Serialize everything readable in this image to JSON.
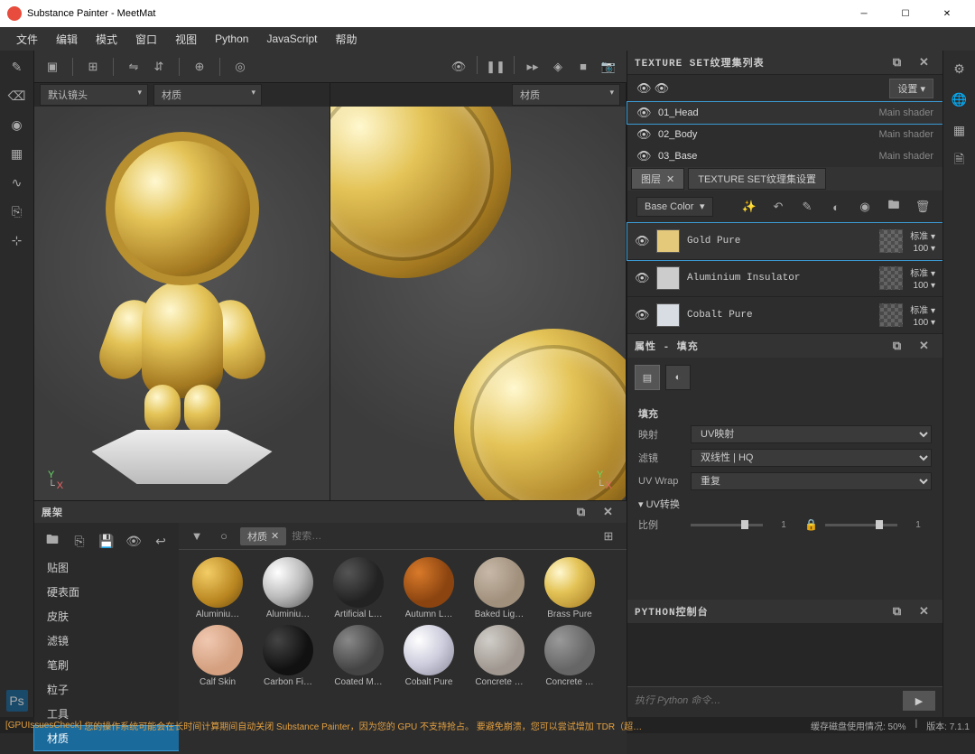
{
  "titlebar": {
    "title": "Substance Painter - MeetMat"
  },
  "menu": {
    "file": "文件",
    "edit": "编辑",
    "mode": "模式",
    "window": "窗口",
    "view": "视图",
    "python": "Python",
    "javascript": "JavaScript",
    "help": "帮助"
  },
  "viewport": {
    "lens": "默认镜头",
    "mat3d": "材质",
    "mat2d": "材质",
    "axis_x": "X",
    "axis_y": "Y"
  },
  "textureset": {
    "title": "TEXTURE SET纹理集列表",
    "settings": "设置",
    "rows": [
      {
        "name": "01_Head",
        "shader": "Main shader"
      },
      {
        "name": "02_Body",
        "shader": "Main shader"
      },
      {
        "name": "03_Base",
        "shader": "Main shader"
      }
    ]
  },
  "tabs": {
    "layers": "图层",
    "ts_settings": "TEXTURE SET纹理集设置"
  },
  "layers": {
    "channel": "Base Color",
    "blend": "标准",
    "opacity": "100",
    "items": [
      {
        "name": "Gold Pure",
        "color": "#e4c97a"
      },
      {
        "name": "Aluminium Insulator",
        "color": "#cccccc"
      },
      {
        "name": "Cobalt Pure",
        "color": "#d8dde4"
      }
    ]
  },
  "props": {
    "title": "属性 - 填充",
    "fill": "填充",
    "projection_label": "映射",
    "projection_value": "UV映射",
    "filtering_label": "滤镜",
    "filtering_value": "双线性 | HQ",
    "uvwrap_label": "UV Wrap",
    "uvwrap_value": "重复",
    "uvtransform": "UV转换",
    "scale_label": "比例",
    "scale_value": "1"
  },
  "console": {
    "title": "PYTHON控制台",
    "placeholder": "执行 Python 命令…"
  },
  "shelf": {
    "title": "展架",
    "search_chip": "材质",
    "search_placeholder": "搜索…",
    "categories": {
      "texture": "贴图",
      "hardsurface": "硬表面",
      "skin": "皮肤",
      "filter": "滤镜",
      "brush": "笔刷",
      "particle": "粒子",
      "tool": "工具",
      "material": "材质"
    },
    "materials": [
      {
        "label": "Aluminiu…",
        "bg": "radial-gradient(circle at 30% 30%, #f3cd66, #b88520 60%, #6b4a10)"
      },
      {
        "label": "Aluminiu…",
        "bg": "radial-gradient(circle at 30% 30%, #fff, #bbb 50%, #555)"
      },
      {
        "label": "Artificial L…",
        "bg": "radial-gradient(circle at 30% 30%, #555, #222 60%)"
      },
      {
        "label": "Autumn L…",
        "bg": "radial-gradient(circle at 30% 30%, #d97a2a, #8b4410 60%)"
      },
      {
        "label": "Baked Lig…",
        "bg": "radial-gradient(circle at 30% 30%, #c8b8a8, #a0907c 60%)"
      },
      {
        "label": "Brass Pure",
        "bg": "radial-gradient(circle at 30% 30%, #fff8d0, #e4c458 40%, #a37820)"
      },
      {
        "label": "Calf Skin",
        "bg": "radial-gradient(circle at 30% 30%, #f0c8b0, #d4a080 60%)"
      },
      {
        "label": "Carbon Fi…",
        "bg": "radial-gradient(circle at 30% 30%, #444, #111 60%)"
      },
      {
        "label": "Coated M…",
        "bg": "radial-gradient(circle at 30% 30%, #888, #444 60%)"
      },
      {
        "label": "Cobalt Pure",
        "bg": "radial-gradient(circle at 30% 30%, #fff, #ccd 50%, #889)"
      },
      {
        "label": "Concrete …",
        "bg": "radial-gradient(circle at 30% 30%, #d0cdc8, #a09890 60%)"
      },
      {
        "label": "Concrete …",
        "bg": "radial-gradient(circle at 30% 30%, #999, #666 60%)"
      }
    ]
  },
  "statusbar": {
    "gpu_prefix": "[GPUIssuesCheck]",
    "gpu_text": "您的操作系统可能会在长时间计算期间自动关闭 Substance Painter，因为您的 GPU 不支持抢占。 要避免崩溃，您可以尝试增加 TDR（超…",
    "cache": "缓存磁盘使用情况:  50%",
    "version": "版本: 7.1.1"
  }
}
